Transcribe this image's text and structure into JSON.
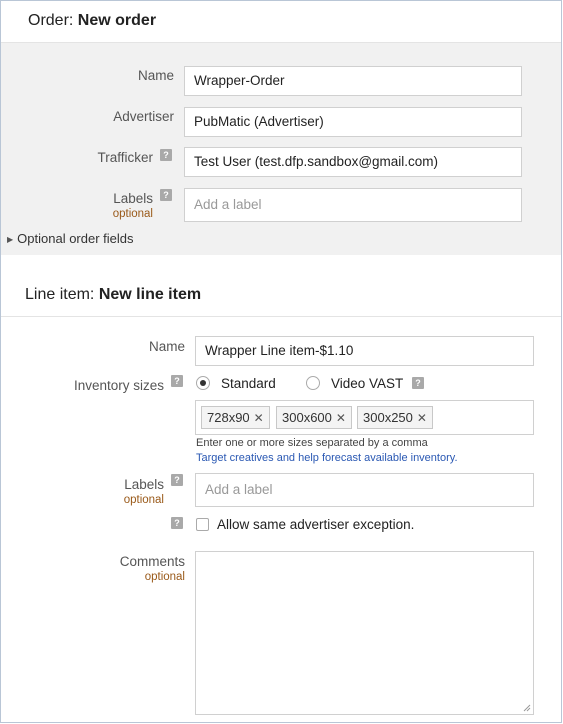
{
  "order": {
    "title_prefix": "Order:",
    "title_name": "New order",
    "name_label": "Name",
    "name_value": "Wrapper-Order",
    "advertiser_label": "Advertiser",
    "advertiser_value": "PubMatic (Advertiser)",
    "trafficker_label": "Trafficker",
    "trafficker_value": "Test User (test.dfp.sandbox@gmail.com)",
    "labels_label": "Labels",
    "labels_optional": "optional",
    "labels_placeholder": "Add a label",
    "optional_fields_toggle": "Optional order fields"
  },
  "line_item": {
    "title_prefix": "Line item:",
    "title_name": "New line item",
    "name_label": "Name",
    "name_value": "Wrapper Line item-$1.10",
    "inventory_sizes_label": "Inventory sizes",
    "size_type_options": [
      "Standard",
      "Video VAST"
    ],
    "size_type_selected": "Standard",
    "sizes": [
      "728x90",
      "300x600",
      "300x250"
    ],
    "sizes_hint": "Enter one or more sizes separated by a comma",
    "sizes_link": "Target creatives and help forecast available inventory.",
    "labels_label": "Labels",
    "labels_optional": "optional",
    "labels_placeholder": "Add a label",
    "advertiser_exception_label": "Allow same advertiser exception.",
    "advertiser_exception_checked": false,
    "comments_label": "Comments",
    "comments_optional": "optional",
    "comments_value": ""
  },
  "icons": {
    "help": "help-icon",
    "remove_chip": "close-icon",
    "expand": "triangle-right-icon"
  },
  "colors": {
    "link": "#2a58b3",
    "optional": "#9a5a1a",
    "help_icon": "#a9a9a9",
    "order_panel_bg": "#f1f1f1"
  }
}
